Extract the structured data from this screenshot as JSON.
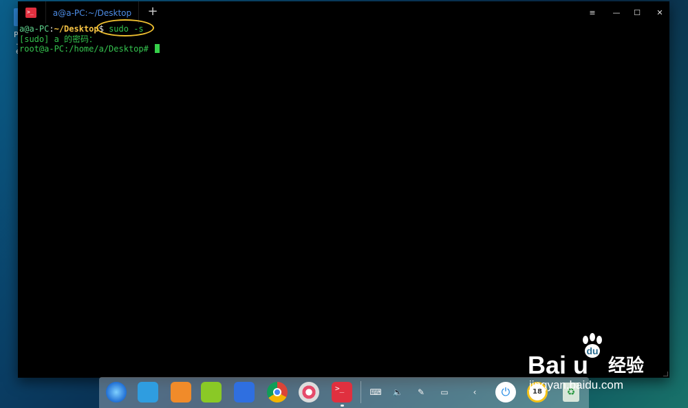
{
  "desktop": {
    "icon_label_1": "P",
    "icon_label_2": "…e"
  },
  "terminal": {
    "tab_title": "a@a-PC:~/Desktop",
    "tab_add_symbol": "+",
    "window_buttons": {
      "menu": "≡",
      "minimize": "—",
      "maximize": "☐",
      "close": "✕"
    },
    "lines": {
      "line1": {
        "user": "a@a-PC",
        "sep": ":",
        "path": "~/Desktop",
        "prompt": "$ ",
        "command": "sudo -s"
      },
      "line2": {
        "text": "[sudo] a 的密码："
      },
      "line3": {
        "text": "root@a-PC:/home/a/Desktop# "
      }
    },
    "colors": {
      "user": "#5fd38d",
      "path": "#f6c344",
      "root_prompt": "#35c44f",
      "cursor": "#36d04a",
      "annotation": "#f0c030"
    }
  },
  "dock": {
    "apps": [
      "deepin-launcher-icon",
      "file-manager-icon",
      "app-store-icon",
      "music-icon",
      "video-icon",
      "chrome-icon",
      "settings-icon",
      "terminal-icon"
    ],
    "terminal_glyph": ">_",
    "tray": {
      "keyboard": "⌨",
      "volume": "🔈",
      "pen": "✎",
      "battery": "▭",
      "collapse": "‹"
    },
    "power_glyph": "⏻",
    "clock_text": "18",
    "trash_glyph": "♻"
  },
  "watermark": {
    "logo_text": "Bai  u",
    "cn_text": "经验",
    "url": "jingyan.baidu.com"
  }
}
